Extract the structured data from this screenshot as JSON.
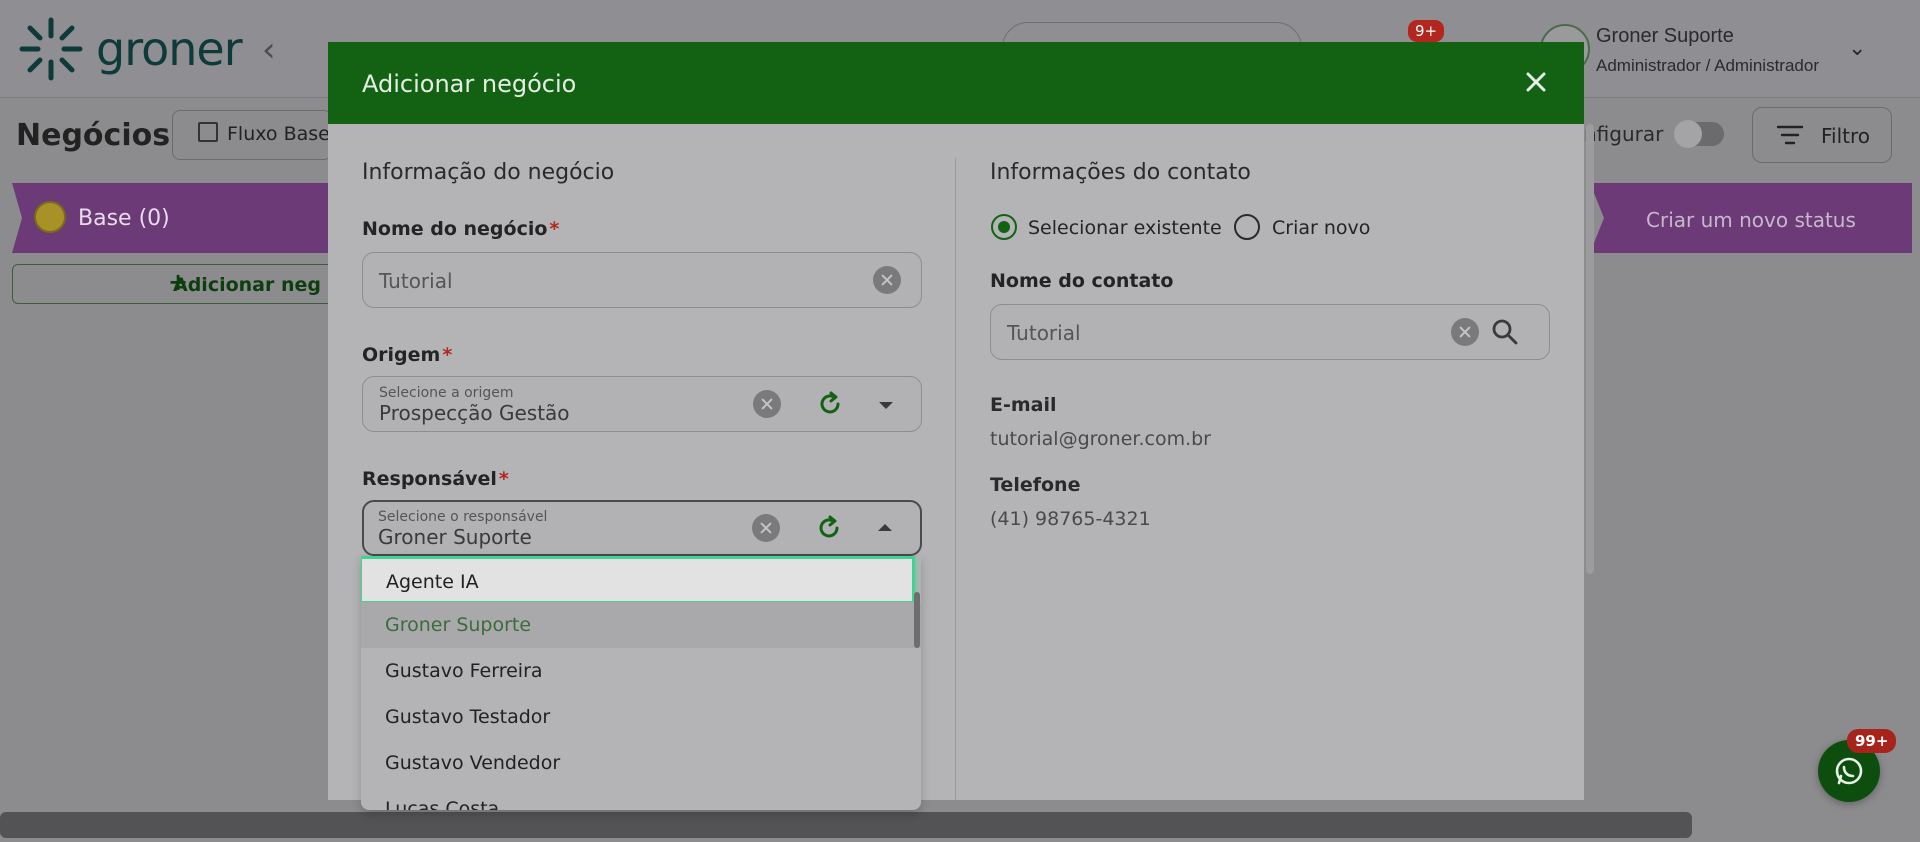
{
  "app": {
    "logo_text": "groner",
    "user_name": "Groner Suporte",
    "user_role": "Administrador / Administrador",
    "notification_badge": "9+"
  },
  "page": {
    "title": "Negócios",
    "flow_button": "Fluxo Base",
    "configure_label": "nfigurar",
    "filter_button": "Filtro",
    "status_base": "Base (0)",
    "status_new": "Criar um novo status",
    "add_deal": "Adicionar neg",
    "chat_badge": "99+"
  },
  "modal": {
    "title": "Adicionar negócio",
    "left": {
      "section_title": "Informação do negócio",
      "deal_name": {
        "label": "Nome do negócio",
        "required": "*",
        "value": "Tutorial"
      },
      "origin": {
        "label": "Origem",
        "required": "*",
        "placeholder": "Selecione a origem",
        "value": "Prospecção Gestão"
      },
      "responsible": {
        "label": "Responsável",
        "required": "*",
        "placeholder": "Selecione o responsável",
        "value": "Groner Suporte"
      },
      "dropdown_options": [
        "Agente IA",
        "Groner Suporte",
        "Gustavo Ferreira",
        "Gustavo Testador",
        "Gustavo Vendedor",
        "Lucas Costa"
      ]
    },
    "right": {
      "section_title": "Informações do contato",
      "radio_existing": "Selecionar existente",
      "radio_new": "Criar novo",
      "contact_name": {
        "label": "Nome do contato",
        "value": "Tutorial"
      },
      "email": {
        "label": "E-mail",
        "value": "tutorial@groner.com.br"
      },
      "phone": {
        "label": "Telefone",
        "value": "(41) 98765-4321"
      }
    }
  },
  "colors": {
    "header_green": "#136213",
    "status_purple": "#6b3a77",
    "hover_outline": "#3fd48f",
    "required_red": "#b3261e"
  }
}
